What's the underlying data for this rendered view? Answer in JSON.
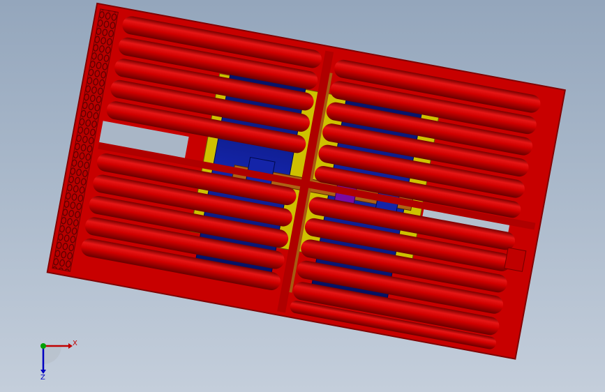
{
  "viewport": {
    "background_top": "#94a6bc",
    "background_bottom": "#c4cedb"
  },
  "model": {
    "frame_color": "#c40000",
    "tube_color": "#d40000",
    "motor_color": "#0c1a8a",
    "shaft_color": "#b06014",
    "base_color": "#d4c400",
    "block_color": "#7a0aa0"
  },
  "triad": {
    "x_label": "X",
    "z_label": "Z",
    "x_color": "#c00000",
    "y_color": "#00a000",
    "z_color": "#0000c0"
  }
}
